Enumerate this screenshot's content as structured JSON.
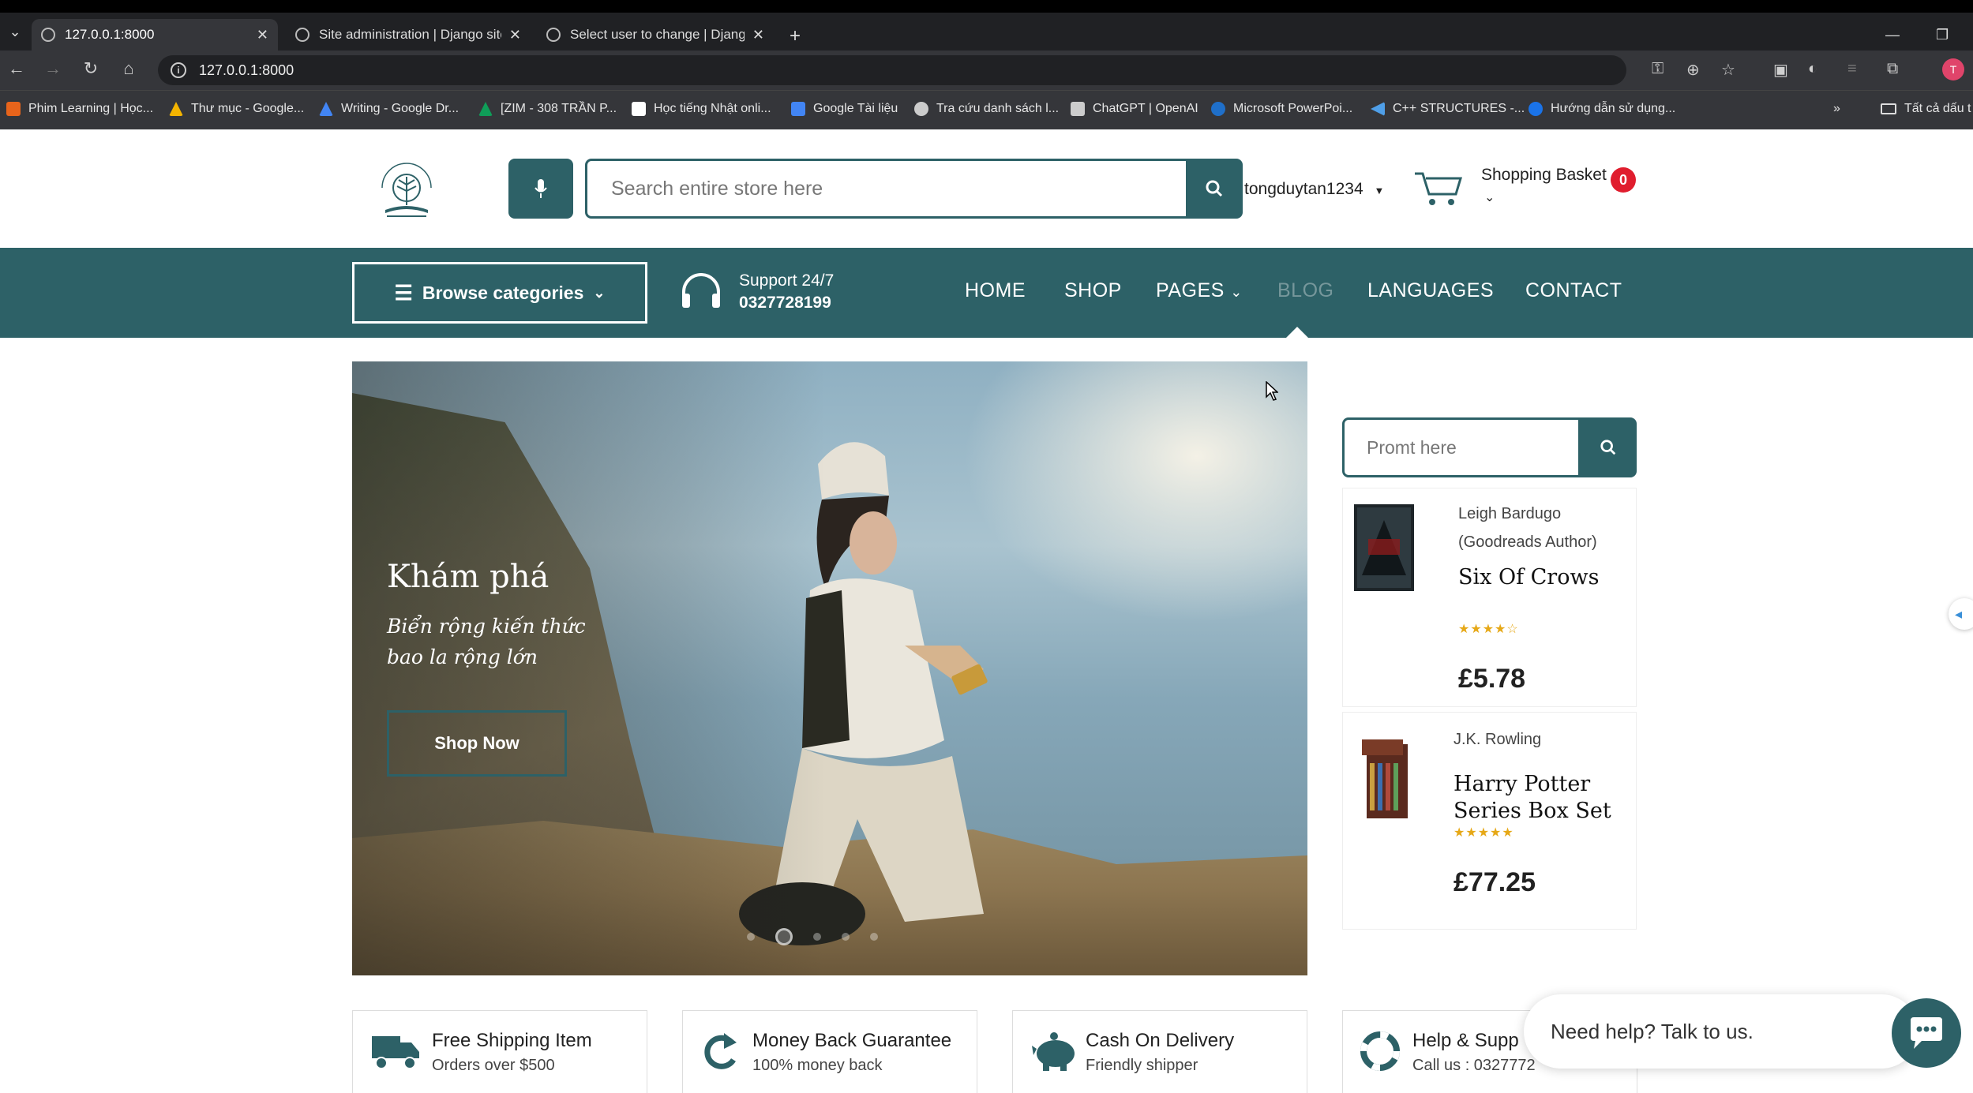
{
  "browser": {
    "tabs": [
      {
        "title": "127.0.0.1:8000",
        "active": true
      },
      {
        "title": "Site administration | Django site",
        "active": false
      },
      {
        "title": "Select user to change | Django",
        "active": false
      }
    ],
    "url": "127.0.0.1:8000",
    "profile_initial": "T",
    "bookmarks": [
      {
        "label": "Phim Learning | Học...",
        "icon": "orange-box-icon",
        "color": "#e8641b"
      },
      {
        "label": "Thư mục - Google...",
        "icon": "google-drive-icon",
        "color": "#f4b400"
      },
      {
        "label": "Writing - Google Dr...",
        "icon": "google-drive-icon",
        "color": "#4285f4"
      },
      {
        "label": "[ZIM - 308 TRẦN P...",
        "icon": "google-drive-icon",
        "color": "#0f9d58"
      },
      {
        "label": "Học tiếng Nhật onli...",
        "icon": "bookmark-icon",
        "color": "#ffffff"
      },
      {
        "label": "Google Tài liệu",
        "icon": "google-docs-icon",
        "color": "#4285f4"
      },
      {
        "label": "Tra cứu danh sách l...",
        "icon": "globe-icon",
        "color": "#cccccc"
      },
      {
        "label": "ChatGPT | OpenAI",
        "icon": "openai-icon",
        "color": "#cccccc"
      },
      {
        "label": "Microsoft PowerPoi...",
        "icon": "edge-icon",
        "color": "#1f6fc9"
      },
      {
        "label": "C++ STRUCTURES -...",
        "icon": "chevron-left-icon",
        "color": "#4f9fe8"
      },
      {
        "label": "Hướng dẫn sử dụng...",
        "icon": "blue-circle-icon",
        "color": "#1a73e8"
      }
    ],
    "more_bookmarks": "»",
    "all_bookmarks": "Tất cả dấu t"
  },
  "header": {
    "search_placeholder": "Search entire store here",
    "username": "tongduytan1234",
    "basket_label": "Shopping Basket",
    "basket_count": "0"
  },
  "nav": {
    "browse_label": "Browse categories",
    "support_title": "Support 24/7",
    "support_phone": "0327728199",
    "links": [
      "HOME",
      "SHOP",
      "PAGES",
      "BLOG",
      "LANGUAGES",
      "CONTACT"
    ]
  },
  "hero": {
    "title": "Khám phá",
    "subtitle": "Biển rộng kiến thức bao la rộng lớn",
    "cta": "Shop Now",
    "slides_total": 5,
    "active_slide": 2
  },
  "sidebar": {
    "prompt_placeholder": "Promt here",
    "books": [
      {
        "author": "Leigh Bardugo (Goodreads Author)",
        "title": "Six Of Crows",
        "rating": 4,
        "rating_text": "★★★★☆",
        "price": "£5.78"
      },
      {
        "author": "J.K. Rowling",
        "title": "Harry Potter Series Box Set",
        "rating": 5,
        "rating_text": "★★★★★",
        "price": "£77.25"
      }
    ]
  },
  "features": [
    {
      "title": "Free Shipping Item",
      "sub": "Orders over $500",
      "icon": "truck-icon"
    },
    {
      "title": "Money Back Guarantee",
      "sub": "100% money back",
      "icon": "refresh-icon"
    },
    {
      "title": "Cash On Delivery",
      "sub": "Friendly shipper",
      "icon": "piggy-bank-icon"
    },
    {
      "title": "Help & Supp",
      "sub": "Call us : 0327772",
      "icon": "lifebuoy-icon"
    }
  ],
  "chat": {
    "prompt": "Need help? Talk to us."
  },
  "colors": {
    "brand": "#2d6167",
    "badge": "#e01d2e",
    "star": "#e6a817"
  }
}
